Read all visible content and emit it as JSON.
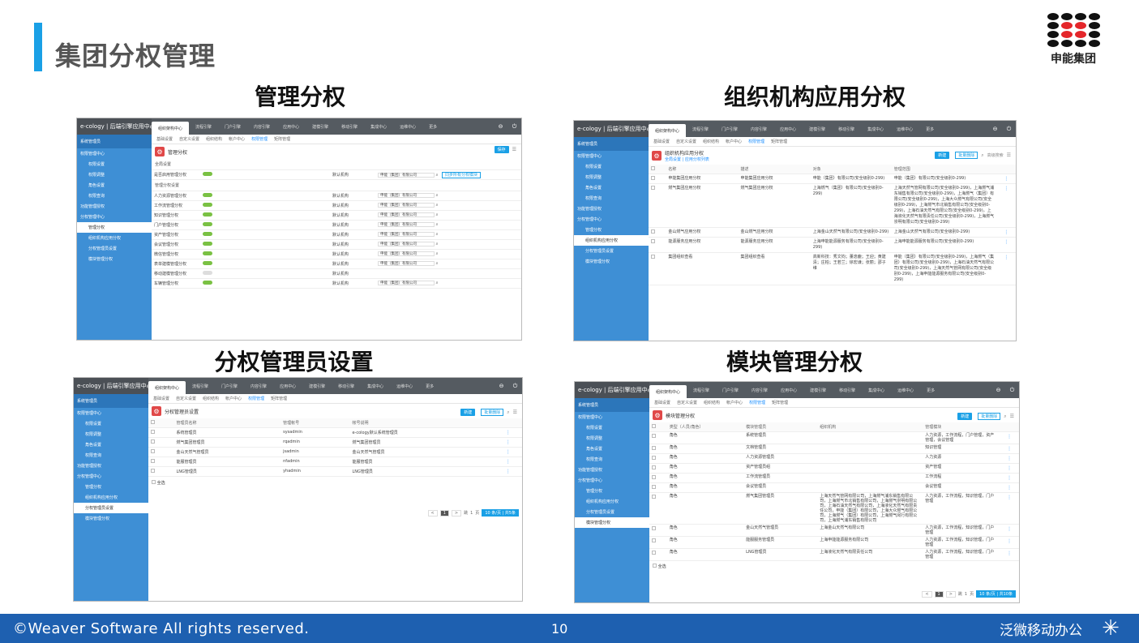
{
  "slide": {
    "title": "集团分权管理",
    "logo_text": "申能集团",
    "footer_copyright": "©Weaver  Software All rights reserved.",
    "page_number": "10",
    "footer_brand": "泛微移动办公"
  },
  "sections": {
    "s1": "管理分权",
    "s2": "组织机构应用分权",
    "s3": "分权管理员设置",
    "s4": "模块管理分权"
  },
  "app": {
    "brand": "e-cology | 后端引擎应用中心",
    "top_tabs": [
      "组织架构中心",
      "流程引擎",
      "门户引擎",
      "内容引擎",
      "应用中心",
      "建模引擎",
      "移动引擎",
      "集成中心",
      "运维中心",
      "更多"
    ],
    "sub_tabs": [
      "基础设置",
      "自定义设置",
      "组织结构",
      "帐户中心",
      "权限管理",
      "矩阵管理"
    ],
    "side_head": "系统管理员",
    "side_items": [
      "权限管理中心",
      "权限设置",
      "权限调整",
      "角色设置",
      "权限查询",
      "功能管理授权",
      "分权管理中心",
      "管理分权",
      "组织机构应用分权",
      "分权管理员设置",
      "模块管理分权"
    ],
    "new_label": "新建",
    "batch_delete": "批量删除",
    "advanced_search": "高级搜索",
    "select_all": "全选",
    "pager": {
      "prev": "<",
      "cur": "1",
      "next": ">",
      "jump": "跳",
      "page1": "1",
      "pages": "页",
      "size": "10 条/页 | 共5条",
      "size2": "10 条/页 | 共10条"
    }
  },
  "p1": {
    "title": "管理分权",
    "save": "保存",
    "group1": "全局设置",
    "group2": "管理分权设置",
    "global_row": {
      "name": "是否启用管理分权",
      "label": "默认机构",
      "value": "申能（集团）有限公司",
      "sync": "同步所有分权模块"
    },
    "rows": [
      {
        "name": "人力资源管理分权",
        "on": true,
        "label": "默认机构",
        "value": "申能（集团）有限公司"
      },
      {
        "name": "工作流管理分权",
        "on": true,
        "label": "默认机构",
        "value": "申能（集团）有限公司"
      },
      {
        "name": "知识管理分权",
        "on": true,
        "label": "默认机构",
        "value": "申能（集团）有限公司"
      },
      {
        "name": "门户管理分权",
        "on": true,
        "label": "默认机构",
        "value": "申能（集团）有限公司"
      },
      {
        "name": "资产管理分权",
        "on": true,
        "label": "默认机构",
        "value": "申能（集团）有限公司"
      },
      {
        "name": "会议管理分权",
        "on": true,
        "label": "默认机构",
        "value": "申能（集团）有限公司"
      },
      {
        "name": "微信管理分权",
        "on": true,
        "label": "默认机构",
        "value": "申能（集团）有限公司"
      },
      {
        "name": "表单建模管理分权",
        "on": true,
        "label": "默认机构",
        "value": "申能（集团）有限公司"
      },
      {
        "name": "移动建模管理分权",
        "on": false,
        "label": "默认机构",
        "value": ""
      },
      {
        "name": "车辆管理分权",
        "on": true,
        "label": "默认机构",
        "value": "申能（集团）有限公司"
      }
    ]
  },
  "p2": {
    "title": "组织机构应用分权",
    "crumb": "全局设置 | 应用分权列表",
    "headers": [
      "名称",
      "描述",
      "对象",
      "管理范围"
    ],
    "rows": [
      {
        "name": "申能集团应用分权",
        "desc": "申能集团应用分权",
        "obj": "申能（集团）有限公司(安全级别0-299)",
        "scope": "申能（集团）有限公司(安全级别0-299)"
      },
      {
        "name": "燃气集团应用分权",
        "desc": "燃气集团应用分权",
        "obj": "上海燃气（集团）有限公司(安全级别0-299)",
        "scope": "上海天然气管网有限公司(安全级别0-299)，上海燃气浦东销售有限公司(安全级别0-299)，上海燃气（集团）有限公司(安全级别0-299)，上海大众燃气有限公司(安全级别0-299)，上海燃气市北销售有限公司(安全级别0-299)，上海石油天然气有限公司(安全级别0-299)，上海液化天然气有限责任公司(安全级别0-299)，上海燃气崇明有限公司(安全级别0-299)"
      },
      {
        "name": "金山燃气应用分权",
        "desc": "金山燃气应用分权",
        "obj": "上海金山天然气有限公司(安全级别0-299)",
        "scope": "上海金山天然气有限公司(安全级别0-299)"
      },
      {
        "name": "能源服务应用分权",
        "desc": "能源服务应用分权",
        "obj": "上海申能能源服务有限公司(安全级别0-299)",
        "scope": "上海申能能源服务有限公司(安全级别0-299)"
      },
      {
        "name": "集团组织查看",
        "desc": "集团组织查看",
        "obj": "高新科技：秀文钧；董逸鹿；王迎；黄建清；庄柏；王若兰；徐宏谦；张丽；邵子维",
        "scope": "申能（集团）有限公司(安全级别0-299)，上海燃气（集团）有限公司(安全级别0-299)，上海石油天然气有限公司(安全级别0-299)，上海天然气管网有限公司(安全级别0-299)，上海申能能源服务有限公司(安全级别0-299)"
      }
    ]
  },
  "p3": {
    "title": "分权管理员设置",
    "headers": [
      "管理员名称",
      "管理帐号",
      "帐号说明"
    ],
    "rows": [
      {
        "name": "系统管理员",
        "acct": "sysadmin",
        "desc": "e-cology默认系统管理员"
      },
      {
        "name": "燃气集团管理员",
        "acct": "rqadmin",
        "desc": "燃气集团管理员"
      },
      {
        "name": "金山天然气管理员",
        "acct": "jsadmin",
        "desc": "金山天然气管理员"
      },
      {
        "name": "能服管理员",
        "acct": "nfadmin",
        "desc": "能服管理员"
      },
      {
        "name": "LNG管理员",
        "acct": "yhadmin",
        "desc": "LNG管理员"
      }
    ]
  },
  "p4": {
    "title": "模块管理分权",
    "headers": [
      "类型（人员/角色）",
      "模块管理员",
      "组织机构",
      "管理模块"
    ],
    "rows": [
      {
        "type": "角色",
        "admin": "系统管理员",
        "org": "",
        "mod": "人力资源，工作流程，门户管理，资产管理，会议管理"
      },
      {
        "type": "角色",
        "admin": "文档管理员",
        "org": "",
        "mod": "知识管理"
      },
      {
        "type": "角色",
        "admin": "人力资源管理员",
        "org": "",
        "mod": "人力资源"
      },
      {
        "type": "角色",
        "admin": "资产管理员组",
        "org": "",
        "mod": "资产管理"
      },
      {
        "type": "角色",
        "admin": "工作流管理员",
        "org": "",
        "mod": "工作流程"
      },
      {
        "type": "角色",
        "admin": "会议管理员",
        "org": "",
        "mod": "会议管理"
      },
      {
        "type": "角色",
        "admin": "燃气集团管理员",
        "org": "上海天然气管网有限公司，上海燃气浦东销售有限公司，上海燃气市北销售有限公司，上海燃气崇明有限公司，上海石油天然气有限公司，上海液化天然气有限责任公司，申能（集团）有限公司，上海大众燃气有限公司，上海燃气（集团）有限公司，上海燃气闵行有限公司，上海燃气浦东销售有限公司",
        "mod": "人力资源，工作流程，知识管理，门户管理"
      },
      {
        "type": "角色",
        "admin": "金山天然气管理员",
        "org": "上海金山天然气有限公司",
        "mod": "人力资源，工作流程，知识管理，门户管理"
      },
      {
        "type": "角色",
        "admin": "能服服务管理员",
        "org": "上海申能能源服务有限公司",
        "mod": "人力资源，工作流程，知识管理，门户管理"
      },
      {
        "type": "角色",
        "admin": "LNG管理员",
        "org": "上海液化天然气有限责任公司",
        "mod": "人力资源，工作流程，知识管理，门户管理"
      }
    ]
  }
}
